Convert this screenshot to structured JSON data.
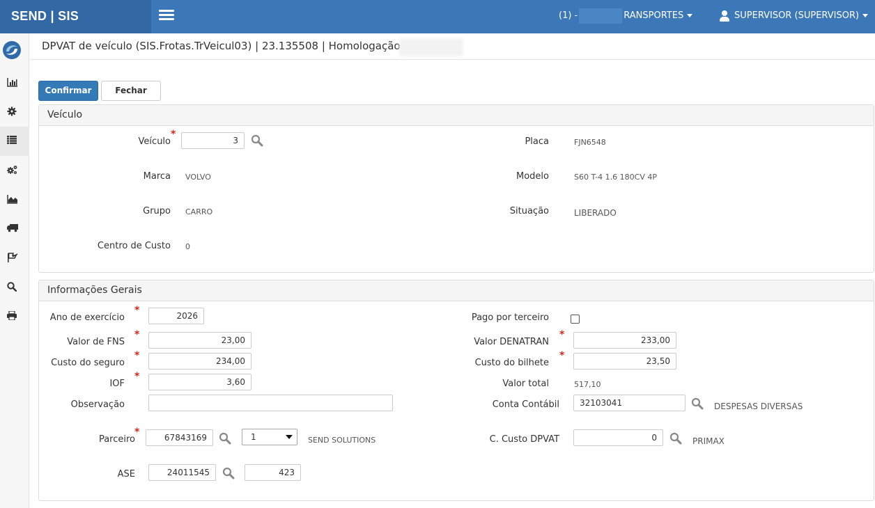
{
  "topbar": {
    "brand": "SEND | SIS",
    "company_prefix": "(1) -",
    "company_suffix": "RANSPORTES",
    "user": "SUPERVISOR (SUPERVISOR)"
  },
  "sidebar": {
    "items": [
      "chart-bar-icon",
      "gear-icon",
      "list-icon",
      "gears-icon",
      "area-chart-icon",
      "truck-icon",
      "flag-icon",
      "search-icon",
      "print-icon"
    ],
    "active_index": 2
  },
  "page": {
    "title": "DPVAT de veículo (SIS.Frotas.TrVeicul03) | 23.135508 | Homologação |"
  },
  "actions": {
    "confirm": "Confirmar",
    "close": "Fechar"
  },
  "veiculo": {
    "heading": "Veículo",
    "veiculo_label": "Veículo",
    "veiculo_value": "3",
    "placa_label": "Placa",
    "placa_value": "FJN6548",
    "marca_label": "Marca",
    "marca_value": "VOLVO",
    "modelo_label": "Modelo",
    "modelo_value": "S60 T-4 1.6 180CV 4P",
    "grupo_label": "Grupo",
    "grupo_value": "CARRO",
    "situacao_label": "Situação",
    "situacao_value": "LIBERADO",
    "centro_label": "Centro de Custo",
    "centro_value": "0"
  },
  "info": {
    "heading": "Informações Gerais",
    "ano_label": "Ano de exercício",
    "ano_value": "2026",
    "pago_label": "Pago por terceiro",
    "pago_checked": false,
    "fns_label": "Valor de FNS",
    "fns_value": "23,00",
    "denatran_label": "Valor DENATRAN",
    "denatran_value": "233,00",
    "seguro_label": "Custo do seguro",
    "seguro_value": "234,00",
    "bilhete_label": "Custo do bilhete",
    "bilhete_value": "23,50",
    "iof_label": "IOF",
    "iof_value": "3,60",
    "total_label": "Valor total",
    "total_value": "517,10",
    "obs_label": "Observação",
    "obs_value": "",
    "conta_label": "Conta Contábil",
    "conta_value": "32103041",
    "conta_desc": "DESPESAS DIVERSAS",
    "parceiro_label": "Parceiro",
    "parceiro_value": "67843169",
    "parceiro_option": "1",
    "parceiro_desc": "SEND SOLUTIONS",
    "ccusto_label": "C. Custo DPVAT",
    "ccusto_value": "0",
    "ccusto_desc": "PRIMAX",
    "ase_label": "ASE",
    "ase_value": "24011545",
    "ase_value2": "423"
  },
  "colors": {
    "topbar": "#3c78b8",
    "brand_bg": "#3268a3",
    "primary": "#337ab7",
    "required": "#d9251d"
  }
}
